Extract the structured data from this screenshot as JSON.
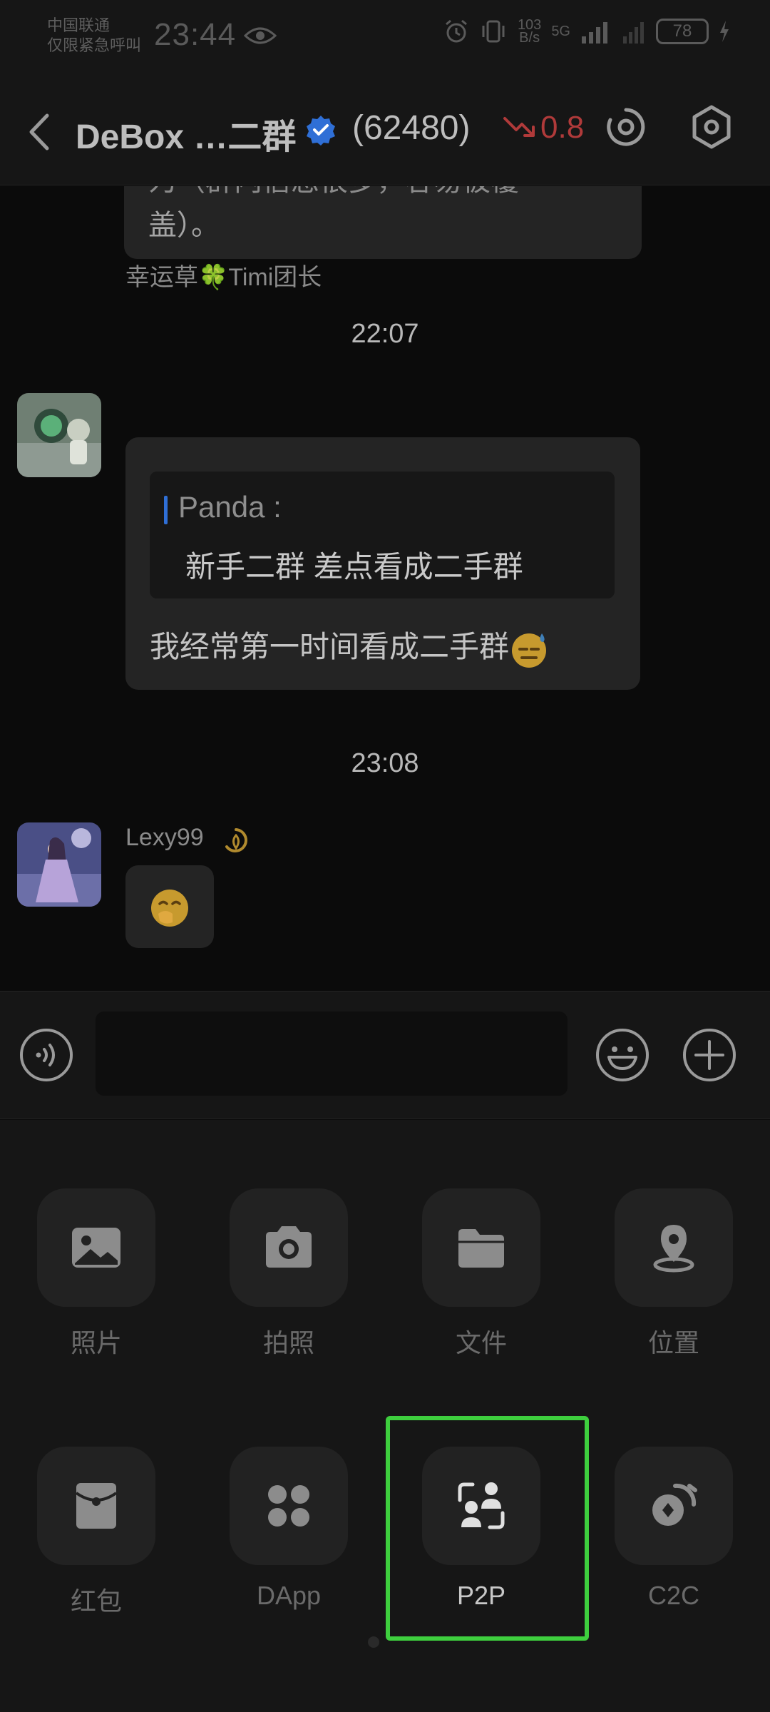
{
  "status_bar": {
    "carrier_line1": "中国联通",
    "carrier_line2": "仅限紧急呼叫",
    "time": "23:44",
    "net_speed_value": "103",
    "net_speed_unit": "B/s",
    "network": "5G",
    "battery": "78"
  },
  "header": {
    "title": "DeBox …二群",
    "member_count": "(62480)",
    "trend_value": "0.8",
    "colors": {
      "verified": "#2f6fd6",
      "trend": "#b03a3a"
    }
  },
  "chat": {
    "previous_bubble": {
      "partial_line": "为（群内信息很多，容易被覆",
      "last_line": "盖）。"
    },
    "messages": [
      {
        "time": "22:07",
        "sender": "幸运草🍀Timi团长",
        "quote_author": "Panda :",
        "quote_text": "新手二群 差点看成二手群",
        "text": "我经常第一时间看成二手群",
        "emoji": "sweat-smile-emoji"
      },
      {
        "time": "23:08",
        "sender": "Lexy99",
        "badge_icon": "crown-badge-icon",
        "emoji": "hand-over-mouth-emoji"
      }
    ]
  },
  "input": {
    "value": "",
    "placeholder": ""
  },
  "panel": {
    "tools": [
      {
        "label": "照片",
        "icon": "image-icon"
      },
      {
        "label": "拍照",
        "icon": "camera-icon"
      },
      {
        "label": "文件",
        "icon": "folder-icon"
      },
      {
        "label": "位置",
        "icon": "location-icon"
      },
      {
        "label": "红包",
        "icon": "red-packet-icon"
      },
      {
        "label": "DApp",
        "icon": "dapp-icon"
      },
      {
        "label": "P2P",
        "icon": "p2p-icon"
      },
      {
        "label": "C2C",
        "icon": "c2c-icon"
      }
    ],
    "highlighted": "P2P",
    "highlight_color": "#3ecf3e"
  }
}
